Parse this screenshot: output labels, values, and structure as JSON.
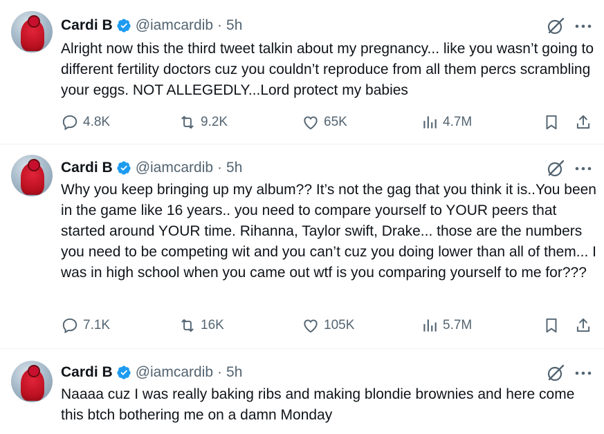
{
  "tweets": [
    {
      "author": "Cardi B",
      "handle": "@iamcardib",
      "separator": "·",
      "time": "5h",
      "text": "Alright now this the third tweet talkin about my pregnancy... like you wasn’t going to different fertility doctors cuz you couldn’t reproduce from all them percs scrambling your eggs. NOT ALLEGEDLY...Lord protect my babies",
      "replies": "4.8K",
      "reposts": "9.2K",
      "likes": "65K",
      "views": "4.7M"
    },
    {
      "author": "Cardi B",
      "handle": "@iamcardib",
      "separator": "·",
      "time": "5h",
      "text": "Why you keep bringing up my album?? It’s not the gag that you think it is..You been in the game like 16 years.. you need to compare yourself to YOUR peers that started around YOUR time. Rihanna, Taylor swift, Drake... those are the numbers you need to be competing wit and you can’t cuz you doing lower than all of them... I was in high school when you came out wtf is you comparing yourself to me for???",
      "replies": "7.1K",
      "reposts": "16K",
      "likes": "105K",
      "views": "5.7M"
    },
    {
      "author": "Cardi B",
      "handle": "@iamcardib",
      "separator": "·",
      "time": "5h",
      "text": "Naaaa cuz I was really baking ribs and making blondie brownies and here come this btch bothering me on a damn Monday"
    }
  ],
  "colors": {
    "verified": "#1d9bf0",
    "secondary_text": "#536471",
    "primary_text": "#0f1419",
    "divider": "#eff3f4"
  },
  "icons": [
    "verified-badge-icon",
    "grok-icon",
    "more-icon",
    "reply-icon",
    "repost-icon",
    "like-icon",
    "views-icon",
    "bookmark-icon",
    "share-icon"
  ]
}
